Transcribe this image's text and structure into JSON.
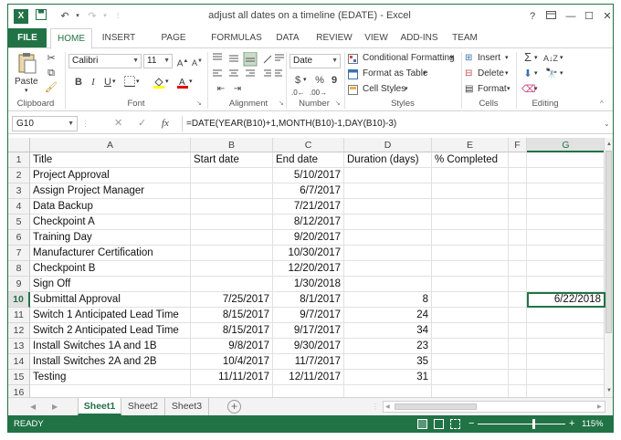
{
  "window": {
    "title": "adjust all dates on a timeline (EDATE) - Excel",
    "help": "?",
    "restore": "□",
    "minimize": "—",
    "maximize": "☐",
    "close": "✕"
  },
  "qat": {
    "save": "💾",
    "undo": "↶",
    "redo": "↷",
    "customize": "⫶"
  },
  "tabs": [
    "FILE",
    "HOME",
    "INSERT",
    "PAGE LAYOUT",
    "FORMULAS",
    "DATA",
    "REVIEW",
    "VIEW",
    "ADD-INS",
    "TEAM"
  ],
  "ribbon": {
    "clipboard_label": "Clipboard",
    "paste_label": "Paste",
    "font_label": "Font",
    "font_name": "Calibri",
    "font_size": "11",
    "bold": "B",
    "italic": "I",
    "underline": "U",
    "alignment_label": "Alignment",
    "number_label": "Number",
    "number_format": "Date",
    "currency": "$",
    "percent": "%",
    "comma": "9",
    "styles_label": "Styles",
    "conditional_formatting": "Conditional Formatting",
    "format_as_table": "Format as Table",
    "cell_styles": "Cell Styles",
    "cells_label": "Cells",
    "insert": "Insert",
    "delete": "Delete",
    "format": "Format",
    "editing_label": "Editing"
  },
  "formula_bar": {
    "name_box": "G10",
    "cancel": "✕",
    "enter": "✓",
    "fx": "fx",
    "formula": "=DATE(YEAR(B10)+1,MONTH(B10)-1,DAY(B10)-3)"
  },
  "columns": [
    "A",
    "B",
    "C",
    "D",
    "E",
    "F",
    "G"
  ],
  "rows": [
    "1",
    "2",
    "3",
    "4",
    "5",
    "6",
    "7",
    "8",
    "9",
    "10",
    "11",
    "12",
    "13",
    "14",
    "15",
    "16"
  ],
  "sheet": {
    "headers": {
      "title": "Title",
      "start": "Start date",
      "end": "End date",
      "duration": "Duration (days)",
      "completed": "% Completed"
    },
    "data": [
      {
        "title": "Project Approval",
        "start": "",
        "end": "5/10/2017",
        "duration": ""
      },
      {
        "title": "Assign Project Manager",
        "start": "",
        "end": "6/7/2017",
        "duration": ""
      },
      {
        "title": "Data Backup",
        "start": "",
        "end": "7/21/2017",
        "duration": ""
      },
      {
        "title": "Checkpoint A",
        "start": "",
        "end": "8/12/2017",
        "duration": ""
      },
      {
        "title": "Training Day",
        "start": "",
        "end": "9/20/2017",
        "duration": ""
      },
      {
        "title": "Manufacturer Certification",
        "start": "",
        "end": "10/30/2017",
        "duration": ""
      },
      {
        "title": "Checkpoint B",
        "start": "",
        "end": "12/20/2017",
        "duration": ""
      },
      {
        "title": "Sign Off",
        "start": "",
        "end": "1/30/2018",
        "duration": ""
      },
      {
        "title": "Submittal Approval",
        "start": "7/25/2017",
        "end": "8/1/2017",
        "duration": "8"
      },
      {
        "title": "Switch 1 Anticipated Lead Time",
        "start": "8/15/2017",
        "end": "9/7/2017",
        "duration": "24"
      },
      {
        "title": "Switch 2 Anticipated Lead Time",
        "start": "8/15/2017",
        "end": "9/17/2017",
        "duration": "34"
      },
      {
        "title": "Install Switches 1A and 1B",
        "start": "9/8/2017",
        "end": "9/30/2017",
        "duration": "23"
      },
      {
        "title": "Install Switches 2A and 2B",
        "start": "10/4/2017",
        "end": "11/7/2017",
        "duration": "35"
      },
      {
        "title": "Testing",
        "start": "11/11/2017",
        "end": "12/11/2017",
        "duration": "31"
      }
    ],
    "g10": "6/22/2018"
  },
  "sheet_tabs": [
    "Sheet1",
    "Sheet2",
    "Sheet3"
  ],
  "add_sheet": "+",
  "status": {
    "mode": "READY",
    "zoom": "115%",
    "zoom_minus": "−",
    "zoom_plus": "+"
  },
  "colors": {
    "accent": "#217346",
    "status_bar": "#217346"
  }
}
